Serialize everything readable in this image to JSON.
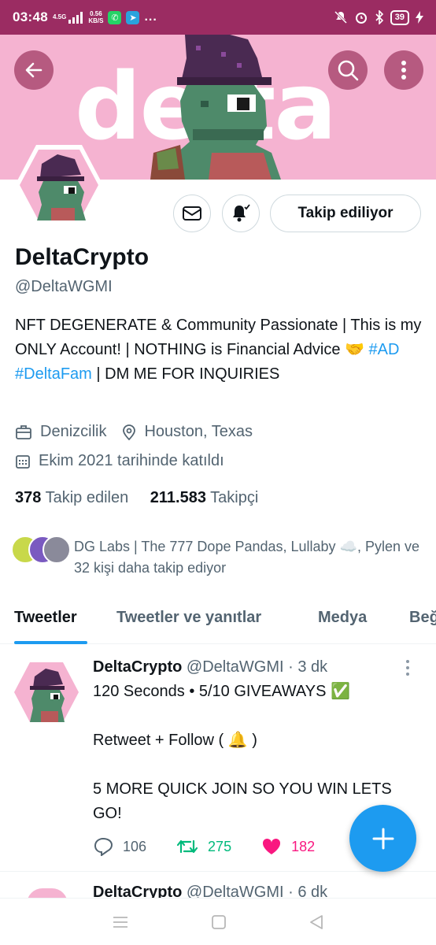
{
  "status_bar": {
    "time": "03:48",
    "network": "4.5G",
    "speed_value": "0.56",
    "speed_unit": "KB/S",
    "battery": "39",
    "more": "..."
  },
  "banner": {
    "word": "delta",
    "background_color": "#f5b3d1"
  },
  "profile": {
    "display_name": "DeltaCrypto",
    "handle": "@DeltaWGMI",
    "follow_button_label": "Takip ediliyor",
    "bio_part1": "NFT DEGENERATE & Community Passionate | This is my ONLY Account! | NOTHING is Financial Advice 🤝 ",
    "bio_tag1": "#AD",
    "bio_tag2": "#DeltaFam",
    "bio_part2": " | DM ME FOR INQUIRIES",
    "category": "Denizcilik",
    "location": "Houston, Texas",
    "joined": "Ekim 2021 tarihinde katıldı",
    "following_count": "378",
    "following_label": "Takip edilen",
    "followers_count": "211.583",
    "followers_label": "Takipçi",
    "followed_by_text": "DG Labs | The 777 Dope Pandas, Lullaby ☁️, Pylen ve 32 kişi daha takip ediyor"
  },
  "tabs": [
    {
      "label": "Tweetler",
      "active": true
    },
    {
      "label": "Tweetler ve yanıtlar",
      "active": false
    },
    {
      "label": "Medya",
      "active": false
    },
    {
      "label": "Beğ",
      "active": false
    }
  ],
  "tweets": [
    {
      "name": "DeltaCrypto",
      "handle": "@DeltaWGMI",
      "time": "· 3 dk",
      "lines": [
        "120 Seconds • 5/10 GIVEAWAYS ✅",
        "",
        "Retweet + Follow ( 🔔 )",
        "",
        "5 MORE QUICK JOIN SO YOU WIN LETS GO!"
      ],
      "replies": "106",
      "retweets": "275",
      "likes": "182"
    },
    {
      "name": "DeltaCrypto",
      "handle": "@DeltaWGMI",
      "time": "· 6 dk"
    }
  ],
  "icons": {
    "back": "arrow-left-icon",
    "search": "search-icon",
    "more": "more-vertical-icon",
    "mail": "mail-icon",
    "bell": "bell-icon",
    "briefcase": "briefcase-icon",
    "location": "location-pin-icon",
    "calendar": "calendar-icon",
    "reply": "reply-icon",
    "retweet": "retweet-icon",
    "like": "heart-icon",
    "compose": "plus-icon"
  },
  "colors": {
    "accent": "#1d9bf0",
    "status_bar": "#9b2c62",
    "retweet": "#00ba7c",
    "like": "#f91880"
  }
}
